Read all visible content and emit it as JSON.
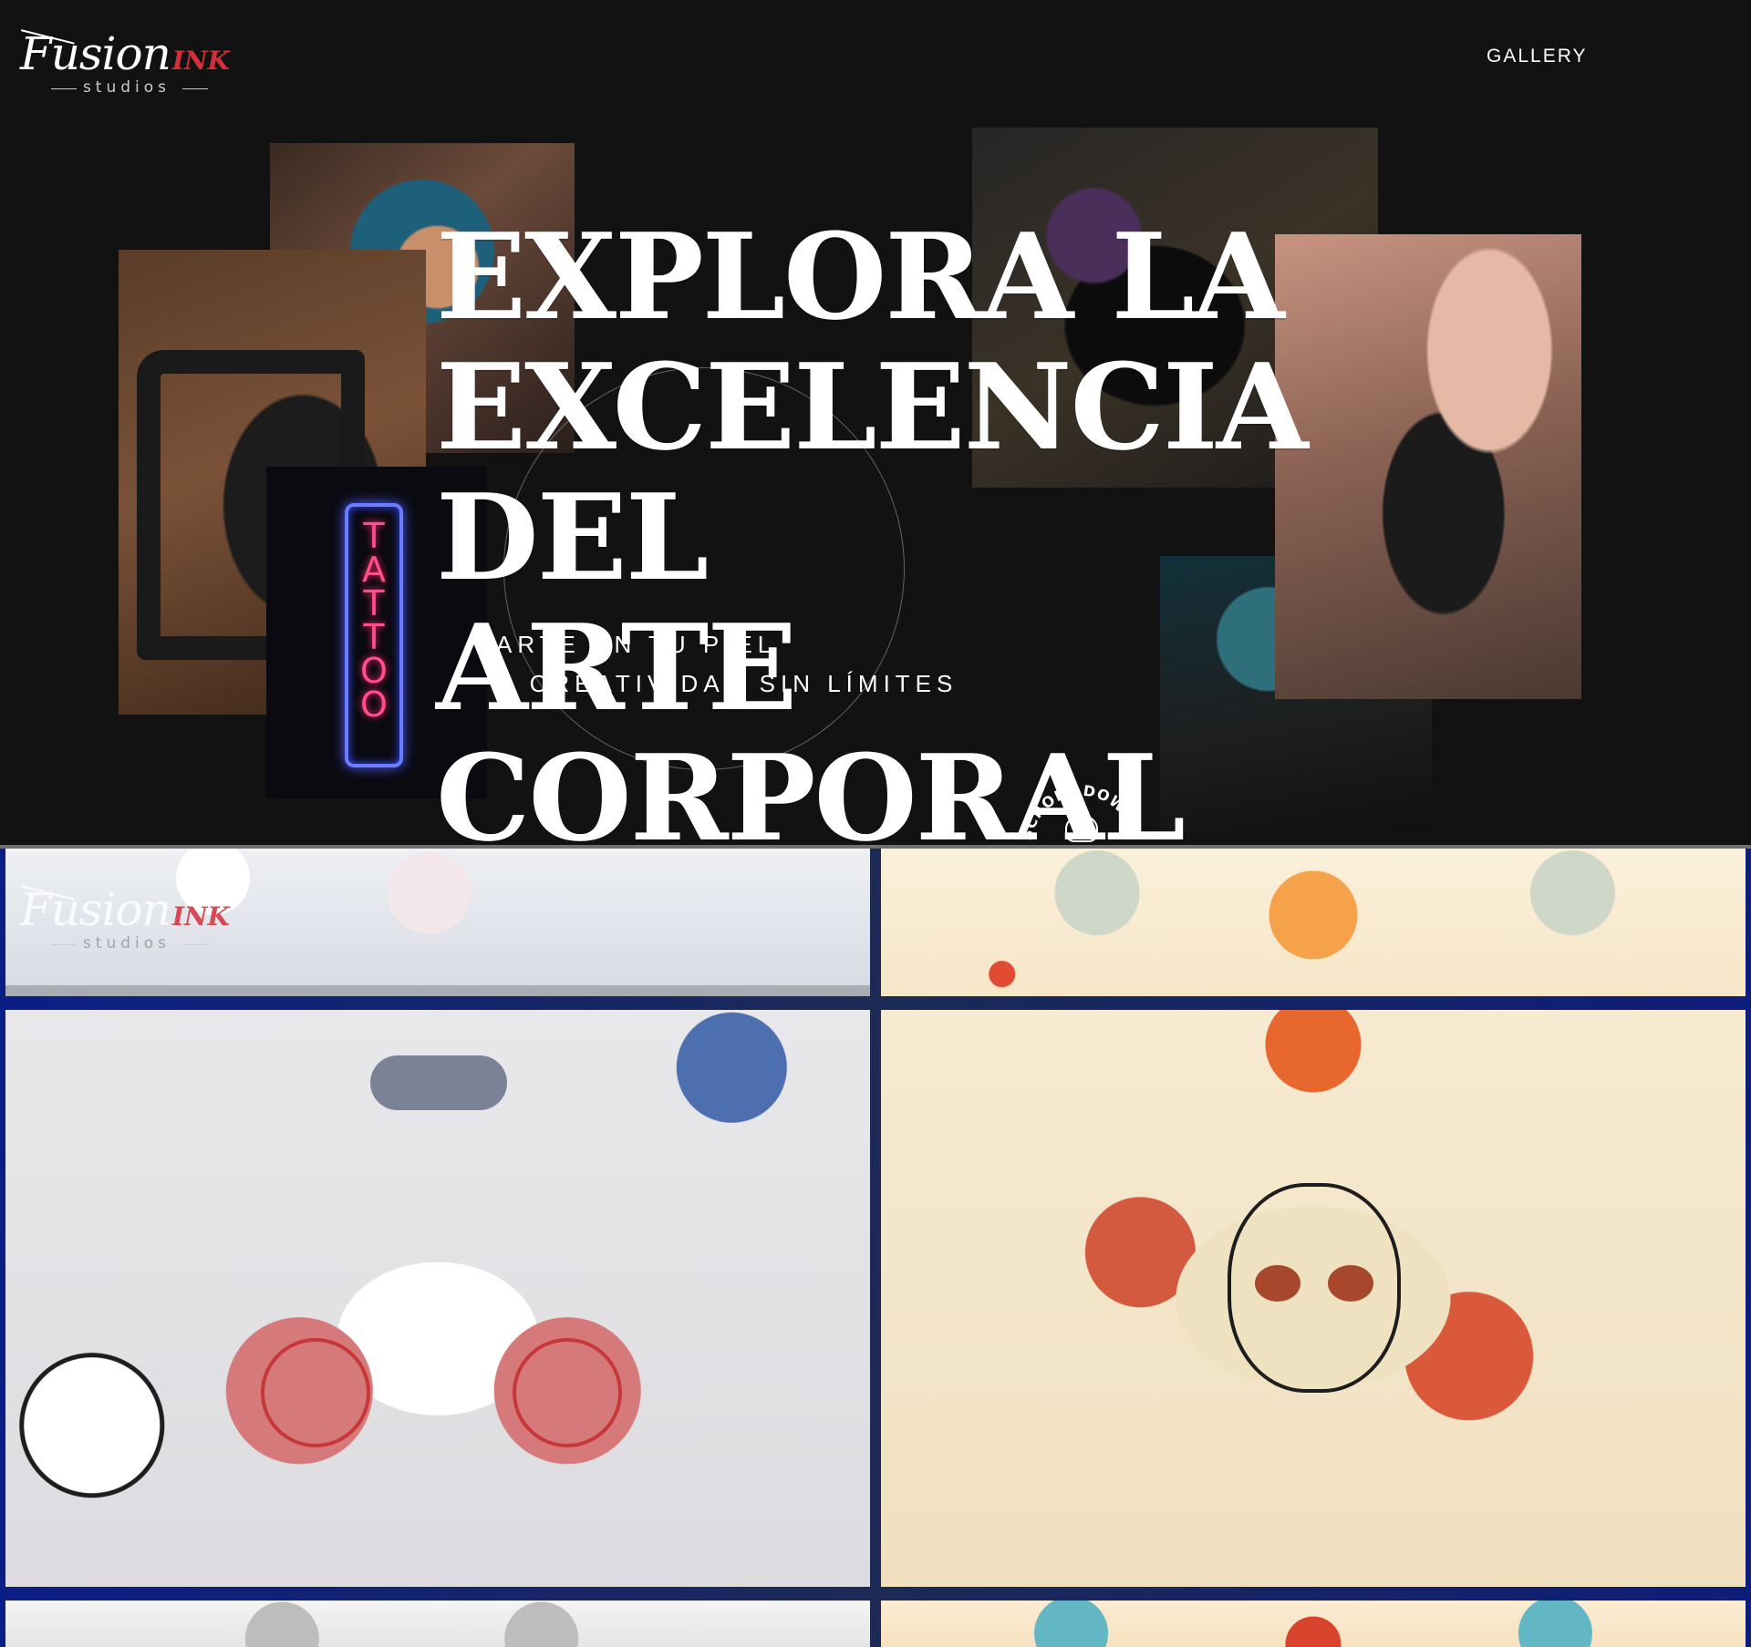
{
  "header": {
    "logo": {
      "word": "Fusion",
      "accent": "INK",
      "sub": "studios"
    },
    "nav": {
      "gallery_label": "GALLERY"
    }
  },
  "hero": {
    "title_lines": [
      "EXPLORA LA",
      "EXCELENCIA DEL",
      "ARTE CORPORAL"
    ],
    "subtitle_lines": [
      "ARTE EN TU PIEL",
      "& CREATIVIDAD SIN LÍMITES"
    ],
    "neon_text": "TATTOO",
    "scroll_text": "SCROLL DOWN FOR"
  },
  "gallery_logo": {
    "word": "Fusion",
    "accent": "INK",
    "sub": "studios"
  },
  "colors": {
    "background": "#121212",
    "accent": "#d32f3a",
    "gallery_border": "#0b1e86",
    "text": "#ffffff"
  },
  "icons": {
    "scroll_emblem": "skull-crown-icon"
  }
}
